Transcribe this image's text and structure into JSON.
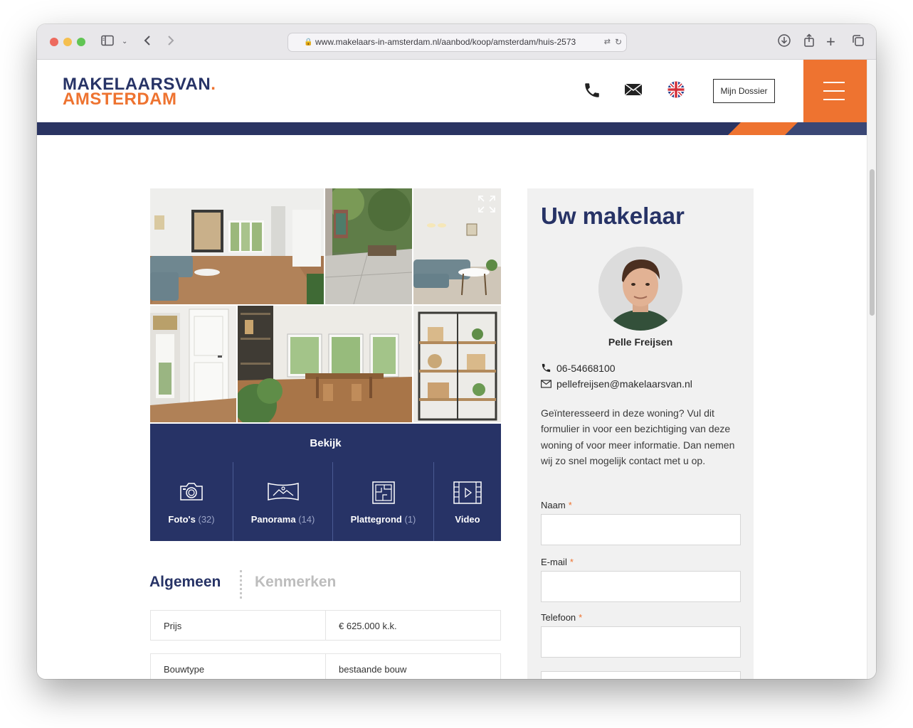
{
  "browser": {
    "url": "www.makelaars-in-amsterdam.nl/aanbod/koop/amsterdam/huis-2573",
    "traffic_lights": {
      "close": "#ed6a5e",
      "minimize": "#f5bf4f",
      "zoom": "#61c554"
    }
  },
  "header": {
    "logo_line1": "MAKELAARSVAN",
    "logo_dot": ".",
    "logo_line2": "AMSTERDAM",
    "dossier_label": "Mijn Dossier",
    "icons": [
      "phone-icon",
      "mail-icon",
      "uk-flag-icon",
      "hamburger-menu-icon"
    ],
    "brand_navy": "#273366",
    "brand_orange": "#ee7330"
  },
  "gallery": {
    "view_label": "Bekijk",
    "media_buttons": [
      {
        "label": "Foto's",
        "count": "(32)",
        "icon": "camera-icon"
      },
      {
        "label": "Panorama",
        "count": "(14)",
        "icon": "panorama-icon"
      },
      {
        "label": "Plattegrond",
        "count": "(1)",
        "icon": "floorplan-icon"
      },
      {
        "label": "Video",
        "count": "",
        "icon": "video-icon"
      }
    ]
  },
  "details": {
    "tabs": [
      "Algemeen",
      "Kenmerken"
    ],
    "rows": [
      {
        "key": "Prijs",
        "value": "€ 625.000 k.k."
      },
      {
        "key": "Bouwtype",
        "value": "bestaande bouw"
      }
    ]
  },
  "agent": {
    "title": "Uw makelaar",
    "name": "Pelle Freijsen",
    "phone": "06-54668100",
    "email": "pellefreijsen@makelaarsvan.nl",
    "intro": "Geïnteresseerd in deze woning? Vul dit formulier in voor een bezichtiging van deze woning of voor meer informatie. Dan nemen wij zo snel mogelijk contact met u op.",
    "form": {
      "name_label": "Naam",
      "email_label": "E-mail",
      "phone_label": "Telefoon",
      "required_mark": "*"
    }
  }
}
